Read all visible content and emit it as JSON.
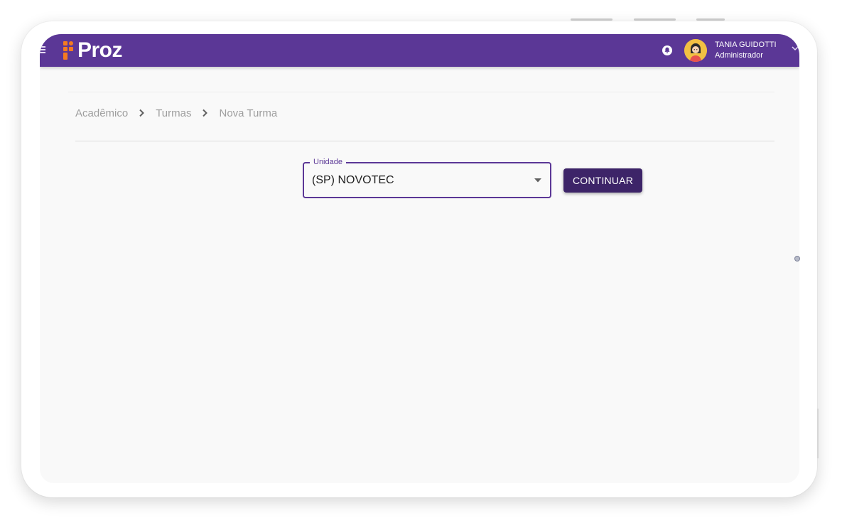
{
  "app": {
    "brand": "Proz"
  },
  "header": {
    "user_name": "TANIA GUIDOTTI",
    "user_role": "Administrador",
    "icons": {
      "menu": "hamburger-icon",
      "notifications": "bell-icon",
      "user_menu": "chevron-down-icon"
    }
  },
  "breadcrumb": {
    "items": [
      {
        "label": "Acadêmico"
      },
      {
        "label": "Turmas"
      },
      {
        "label": "Nova Turma"
      }
    ]
  },
  "form": {
    "unidade_label": "Unidade",
    "unidade_value": "(SP) NOVOTEC",
    "continue_label": "CONTINUAR"
  },
  "colors": {
    "primary": "#5b3796",
    "button": "#3d2468",
    "accent_logo": "#f47b20",
    "background": "#f9f9f9"
  }
}
